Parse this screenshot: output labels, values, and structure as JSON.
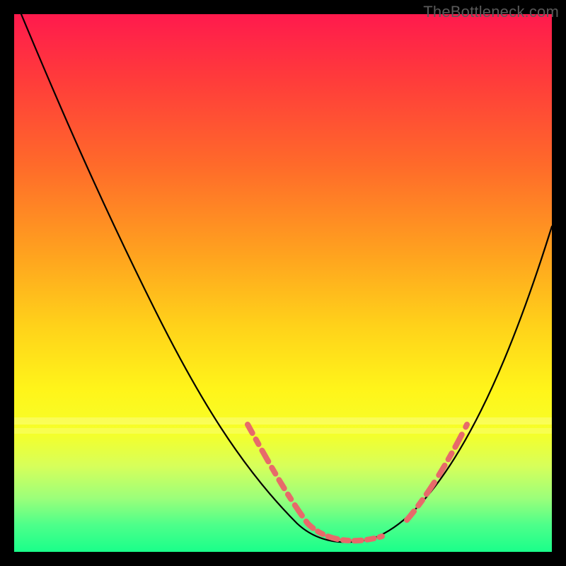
{
  "watermark": "TheBottleneck.com",
  "colors": {
    "curve": "#000000",
    "dash": "#e76a6a",
    "gradient_top": "#ff1a4d",
    "gradient_bottom": "#1aff8a",
    "frame": "#000000"
  },
  "chart_data": {
    "type": "line",
    "title": "",
    "xlabel": "",
    "ylabel": "",
    "xlim": [
      0,
      100
    ],
    "ylim": [
      0,
      100
    ],
    "grid": false,
    "legend": false,
    "annotations": [
      "TheBottleneck.com"
    ],
    "series": [
      {
        "name": "bottleneck-curve",
        "x": [
          0,
          5,
          10,
          15,
          20,
          25,
          30,
          35,
          40,
          45,
          50,
          55,
          58,
          60,
          63,
          66,
          70,
          75,
          80,
          85,
          90,
          95,
          100
        ],
        "y": [
          100,
          91,
          82,
          72,
          63,
          53,
          44,
          35,
          27,
          19,
          12,
          6,
          3,
          1,
          0,
          0,
          1,
          4,
          10,
          19,
          30,
          44,
          60
        ]
      }
    ],
    "highlight_segments": [
      {
        "name": "descending-dash",
        "x_range": [
          45,
          58
        ]
      },
      {
        "name": "valley-floor-dash",
        "x_range": [
          58,
          68
        ]
      },
      {
        "name": "ascending-dash",
        "x_range": [
          72,
          82
        ]
      }
    ]
  }
}
